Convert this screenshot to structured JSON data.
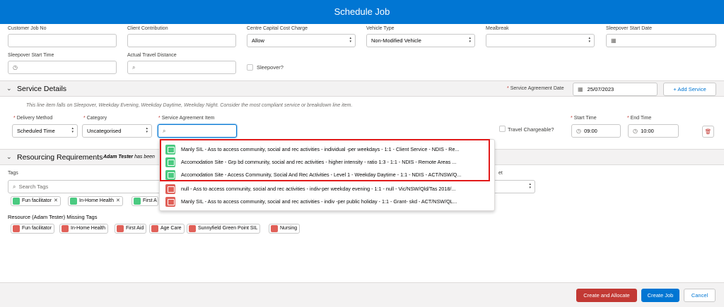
{
  "modal": {
    "title": "Schedule Job"
  },
  "fields_row1": [
    {
      "label": "Customer Job No",
      "value": ""
    },
    {
      "label": "Client Contribution",
      "value": ""
    },
    {
      "label": "Centre Capital Cost Charge",
      "value": "Allow"
    },
    {
      "label": "Vehicle Type",
      "value": "Non-Modified Vehicle"
    },
    {
      "label": "Mealbreak",
      "value": ""
    },
    {
      "label": "Sleepover Start Date",
      "value": ""
    }
  ],
  "fields_row2": {
    "sleepover_start_time_label": "Sleepover Start Time",
    "actual_travel_distance_label": "Actual Travel Distance",
    "sleepover_label": "Sleepover?"
  },
  "service_details": {
    "title": "Service Details",
    "agreement_date_label": "Service Agreement Date",
    "agreement_date_value": "25/07/2023",
    "add_service_label": "Add Service",
    "note": "This line item falls on Sleepover, Weekday Evening, Weekday Daytime, Weekday Night. Consider the most compliant service or breakdown line item.",
    "delivery_method_label": "Delivery Method",
    "delivery_method_value": "Scheduled Time",
    "category_label": "Category",
    "category_value": "Uncategorised",
    "service_agreement_item_label": "Service Agreement Item",
    "service_agreement_item_value": "",
    "travel_chargeable_label": "Travel Chargeable?",
    "start_time_label": "Start Time",
    "start_time_value": "09:00",
    "end_time_label": "End Time",
    "end_time_value": "10:00"
  },
  "dropdown_items": [
    {
      "text": "Manly SIL - Ass to access community, social and rec activities - individual -per weekdays - 1:1 - Client Service - NDIS - Re...",
      "status": "green"
    },
    {
      "text": "Accomodation Site - Grp bd community, social and rec activities - higher intensity - ratio 1:3 - 1:1 - NDIS - Remote Areas ...",
      "status": "green"
    },
    {
      "text": "Accomodation Site - Access Community, Social And Rec Activities - Level 1 - Weekday Daytime - 1:1 - NDIS - ACT/NSW/Q...",
      "status": "green"
    },
    {
      "text": "null - Ass to access community, social and rec activities - indiv-per weekday evening - 1:1 - null - Vic/NSW/Qld/Tas 2018/...",
      "status": "red"
    },
    {
      "text": "Manly SIL - Ass to access community, social and rec activities - indiv -per public holiday - 1:1 - Grant- skd - ACT/NSW/QL...",
      "status": "red"
    }
  ],
  "resourcing": {
    "title": "Resourcing Requirements",
    "tester_name": "Adam Tester",
    "tester_suffix": " has been",
    "tags_label": "Tags",
    "search_placeholder": "Search Tags",
    "partial_label": "et",
    "tags": [
      "Fun facilitator",
      "In-Home Health",
      "First A"
    ],
    "missing_label": "Resource (Adam Tester) Missing Tags",
    "missing_tags": [
      "Fun facilitator",
      "In-Home Health",
      "First Aid",
      "Age Care",
      "Sunnyfield Green Point SIL",
      "Nursing"
    ]
  },
  "footer": {
    "create_allocate": "Create and Allocate",
    "create_job": "Create Job",
    "cancel": "Cancel"
  },
  "colors": {
    "brand": "#0176d3",
    "destructive": "#c23934",
    "tag_ok": "#4bca81",
    "tag_missing": "#e06058",
    "highlight": "#e21a1a"
  }
}
